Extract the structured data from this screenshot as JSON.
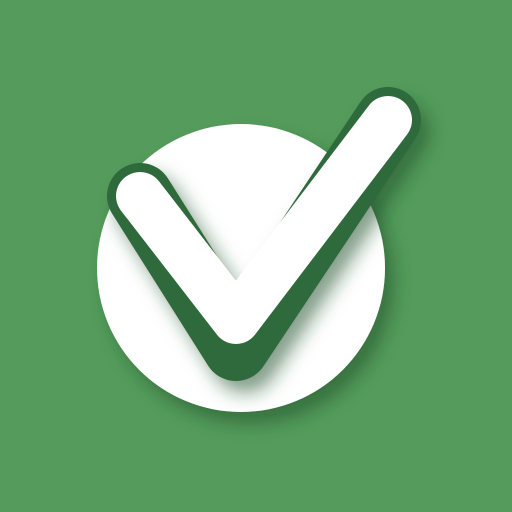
{
  "icon": {
    "name": "checkmark-in-circle-icon",
    "colors": {
      "background": "#559C5C",
      "circle": "#FFFFFF",
      "check_outline": "#2E6A3A",
      "check_fill": "#FFFFFF",
      "shadow": "#1E4F28"
    }
  }
}
